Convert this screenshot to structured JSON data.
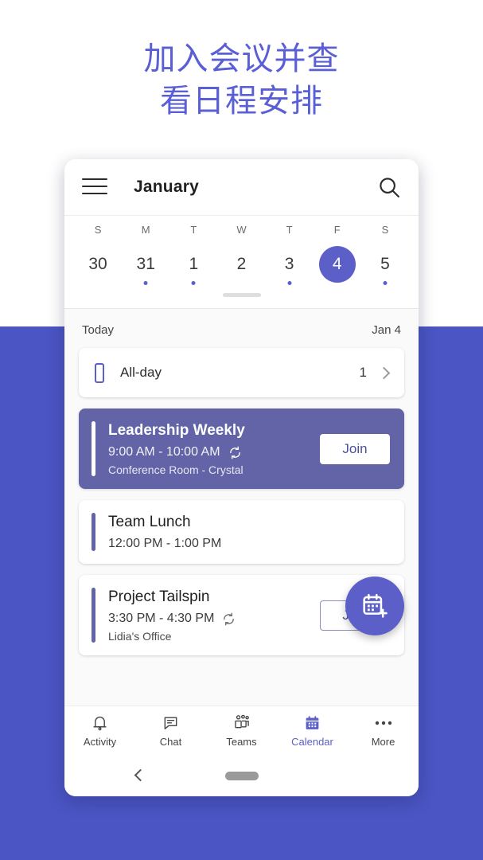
{
  "page": {
    "headline": "加入会议并查\n看日程安排",
    "headline_color": "#5b5fd6",
    "background_color": "#4b55c4"
  },
  "appbar": {
    "title": "January",
    "menu_icon": "hamburger-icon",
    "search_icon": "search-icon"
  },
  "calendar": {
    "day_labels": [
      "S",
      "M",
      "T",
      "W",
      "T",
      "F",
      "S"
    ],
    "days": [
      {
        "num": "30",
        "dot": false,
        "selected": false
      },
      {
        "num": "31",
        "dot": true,
        "selected": false
      },
      {
        "num": "1",
        "dot": true,
        "selected": false
      },
      {
        "num": "2",
        "dot": false,
        "selected": false
      },
      {
        "num": "3",
        "dot": true,
        "selected": false
      },
      {
        "num": "4",
        "dot": false,
        "selected": true
      },
      {
        "num": "5",
        "dot": true,
        "selected": false
      }
    ],
    "selected_color": "#5b5fc7"
  },
  "agenda": {
    "today_label": "Today",
    "today_date": "Jan 4",
    "allday": {
      "label": "All-day",
      "count": "1",
      "icon": "allday-bar-icon",
      "chevron": "chevron-right-icon"
    },
    "events": [
      {
        "title": "Leadership Weekly",
        "time": "9:00 AM - 10:00 AM",
        "location": "Conference Room -  Crystal",
        "recurring": true,
        "join_label": "Join",
        "highlighted": true
      },
      {
        "title": "Team Lunch",
        "time": "12:00 PM - 1:00 PM",
        "location": "",
        "recurring": false,
        "join_label": "",
        "highlighted": false
      },
      {
        "title": "Project Tailspin",
        "time": "3:30 PM - 4:30 PM",
        "location": "Lidia's Office",
        "recurring": true,
        "join_label": "Join",
        "highlighted": false
      }
    ],
    "fab": {
      "icon": "calendar-add-icon",
      "color": "#5b5fc7"
    }
  },
  "bottom_nav": {
    "items": [
      {
        "label": "Activity",
        "icon": "bell-icon",
        "active": false
      },
      {
        "label": "Chat",
        "icon": "chat-icon",
        "active": false
      },
      {
        "label": "Teams",
        "icon": "teams-icon",
        "active": false
      },
      {
        "label": "Calendar",
        "icon": "calendar-icon",
        "active": true
      },
      {
        "label": "More",
        "icon": "more-icon",
        "active": false
      }
    ],
    "active_color": "#5b5fc7"
  },
  "system_nav": {
    "back_icon": "back-chevron-icon",
    "home_icon": "home-indicator"
  }
}
